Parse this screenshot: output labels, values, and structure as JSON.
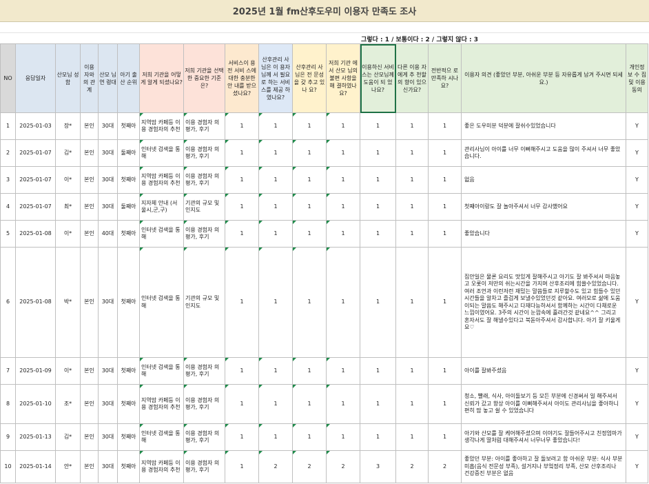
{
  "title": "2025년 1월 fm산후도우미 이용자 만족도 조사",
  "legend": "그렇다 : 1 / 보통이다 : 2 / 그렇지 않다 : 3",
  "columns": [
    {
      "label": "NO",
      "bg": "gray"
    },
    {
      "label": "응답일자",
      "bg": "blue"
    },
    {
      "label": "산모님 성함",
      "bg": "blue"
    },
    {
      "label": "이용 자와 의 관 계",
      "bg": "blue"
    },
    {
      "label": "산모 님 연 령대",
      "bg": "blue"
    },
    {
      "label": "아기 출산 순위",
      "bg": "blue"
    },
    {
      "label": "저희 기관을 어떻게 알게 되셨나요?",
      "bg": "pink"
    },
    {
      "label": "저희 기관을 선택한 중요한 기준 은?",
      "bg": "pink"
    },
    {
      "label": "서비스이 용 전 서비 스에 대한 충분한 안 내를 받으 셨나요?",
      "bg": "orange"
    },
    {
      "label": "산후관리 사님은 이 용자님께 서 필요로 하는 서비 스를 제공 하였나요?",
      "bg": "lblue"
    },
    {
      "label": "산후관리 사님은 전 문성을 갖 추고 있나 요?",
      "bg": "yellow"
    },
    {
      "label": "저희 기관 에서 산모 님의 불편 사항을 해 결하였나 요?",
      "bg": "yellow"
    },
    {
      "label": "이용하신 서비스는 산모님께 도움이 되 었나요?",
      "bg": "green"
    },
    {
      "label": "다른 이용 자에게 추 천할 의 향이 있으 신가요?",
      "bg": "green"
    },
    {
      "label": "전반적으 로 만족하 시나요?",
      "bg": "green"
    },
    {
      "label": "이용자 의견 (좋았던 부분, 아쉬운 부분 등 자유롭게 남겨 주시면 되세요.)",
      "bg": "green"
    },
    {
      "label": "개인정 보 수 집 및 이용 동의",
      "bg": "green"
    }
  ],
  "rows": [
    {
      "no": "1",
      "date": "2025-01-03",
      "name": "장*",
      "relation": "본인",
      "age": "30대",
      "birth_order": "첫째아",
      "found_via": "지역맘 카페등 이용 경험자의 추천",
      "criteria": "이용 경험자 의 평가, 후기",
      "q1": "1",
      "q2": "1",
      "q3": "1",
      "q4": "1",
      "q5": "1",
      "q6": "1",
      "q7": "1",
      "opinion": "좋은 도우미분 덕분에 잘쉬수있었습니다",
      "consent": "Y"
    },
    {
      "no": "2",
      "date": "2025-01-07",
      "name": "김*",
      "relation": "본인",
      "age": "30대",
      "birth_order": "둘째아",
      "found_via": "인터넷 검색을 통해",
      "criteria": "이용 경험자 의 평가, 후기",
      "q1": "1",
      "q2": "1",
      "q3": "1",
      "q4": "1",
      "q5": "1",
      "q6": "1",
      "q7": "1",
      "opinion": "관리사님이 아이를 너무 이뻐해주시고 도움을 많이 주셔서 너무 좋았습니다.",
      "consent": "Y"
    },
    {
      "no": "3",
      "date": "2025-01-07",
      "name": "이*",
      "relation": "본인",
      "age": "30대",
      "birth_order": "첫째아",
      "found_via": "지역맘 카페등 이용 경험자의 추천",
      "criteria": "이용 경험자 의 평가, 후기",
      "q1": "1",
      "q2": "1",
      "q3": "1",
      "q4": "1",
      "q5": "1",
      "q6": "1",
      "q7": "1",
      "opinion": "없음",
      "consent": "Y"
    },
    {
      "no": "4",
      "date": "2025-01-07",
      "name": "최*",
      "relation": "본인",
      "age": "30대",
      "birth_order": "둘째아",
      "found_via": "지자체 안내 (서울시,군,구)",
      "criteria": "기관의 규모 및 인지도",
      "q1": "1",
      "q2": "1",
      "q3": "1",
      "q4": "1",
      "q5": "1",
      "q6": "1",
      "q7": "1",
      "opinion": "첫째아이랑도 잘 놀아주셔서 너무 감사했어요",
      "consent": "Y"
    },
    {
      "no": "5",
      "date": "2025-01-08",
      "name": "이*",
      "relation": "본인",
      "age": "40대",
      "birth_order": "첫째아",
      "found_via": "인터넷 검색을 통해",
      "criteria": "이용 경험자 의 평가, 후기",
      "q1": "1",
      "q2": "1",
      "q3": "1",
      "q4": "1",
      "q5": "1",
      "q6": "1",
      "q7": "1",
      "opinion": "좋았습니다",
      "consent": "Y"
    },
    {
      "no": "6",
      "date": "2025-01-08",
      "name": "박*",
      "relation": "본인",
      "age": "30대",
      "birth_order": "첫째아",
      "found_via": "인터넷 검색을 통해",
      "criteria": "기관의 규모 및 인지도",
      "q1": "1",
      "q2": "1",
      "q3": "1",
      "q4": "1",
      "q5": "1",
      "q6": "1",
      "q7": "1",
      "opinion": "집안일은 물론 요리도 맛있게 잘해주시고 아기도 잘 봐주셔서 마음놓고 오롯이 저만의 쉬는시간을 가지며 산후조리에 힘쓸수있었습니다. 여러 조언과 이런저런 재밌는 말씀들로 지루할수도 있고 힘들수 있던 시간들을 알차고 즐겁게 보낼수있었던것 같아요. 여러모로 삶에 도움이되는 말씀도 해주시고 다재다능하셔서 함께하는 시간이 다채로운 느낌이였어요. 3주의 시간이 눈깜속에 흘러간것 같네요^^ 그리고 혼자서도 잘 해낼수있다고 북돋아주셔서 감사합니다. 아기 잘 키울게요♡",
      "consent": "Y"
    },
    {
      "no": "7",
      "date": "2025-01-09",
      "name": "이*",
      "relation": "본인",
      "age": "30대",
      "birth_order": "첫째아",
      "found_via": "인터넷 검색을 통해",
      "criteria": "이용 경험자 의 평가, 후기",
      "q1": "1",
      "q2": "1",
      "q3": "1",
      "q4": "1",
      "q5": "1",
      "q6": "1",
      "q7": "1",
      "opinion": "아이를 잘봐주셨음",
      "consent": "Y"
    },
    {
      "no": "8",
      "date": "2025-01-10",
      "name": "조*",
      "relation": "본인",
      "age": "30대",
      "birth_order": "첫째아",
      "found_via": "지역맘 카페등 이용 경험자의 추천",
      "criteria": "이용 경험자 의 평가, 후기",
      "q1": "1",
      "q2": "1",
      "q3": "1",
      "q4": "1",
      "q5": "1",
      "q6": "1",
      "q7": "1",
      "opinion": "청소, 빨래, 식사, 아이돌보기 등 모든 부분에 신경써서 일 해주셔서 신뢰가 갔고 항상 아이를 이뻐해주셔서 아이도 관리사님을 좋아하니 편히 맘 놓고 쉴 수 있었습니다",
      "consent": "Y"
    },
    {
      "no": "9",
      "date": "2025-01-13",
      "name": "김*",
      "relation": "본인",
      "age": "30대",
      "birth_order": "첫째아",
      "found_via": "인터넷 검색을 통해",
      "criteria": "이용 경험자 의 평가, 후기",
      "q1": "1",
      "q2": "1",
      "q3": "1",
      "q4": "1",
      "q5": "1",
      "q6": "1",
      "q7": "1",
      "opinion": "아기와 산모를 잘 케어해주셨으며 이야기도 잘들어주시고 친정엄마가 생각나게 딸처럼 대해주셔서 너무너무 좋았습니다!",
      "consent": "Y"
    },
    {
      "no": "10",
      "date": "2025-01-14",
      "name": "안*",
      "relation": "본인",
      "age": "30대",
      "birth_order": "첫째아",
      "found_via": "지역맘 카페등 이용 경험자의 추천",
      "criteria": "이용 경험자 의 평가, 후기",
      "q1": "1",
      "q2": "2",
      "q3": "2",
      "q4": "2",
      "q5": "3",
      "q6": "2",
      "q7": "2",
      "opinion": "좋았던 부분: 아이를 좋아하고 잘 돌보려고 함 아쉬운 부분: 식사 부분 미흡(음식 전문성 부족), 설거지나 부엌정리 부족, 산모 산후조리나 건강증진 부분은 없음",
      "consent": "Y"
    }
  ]
}
